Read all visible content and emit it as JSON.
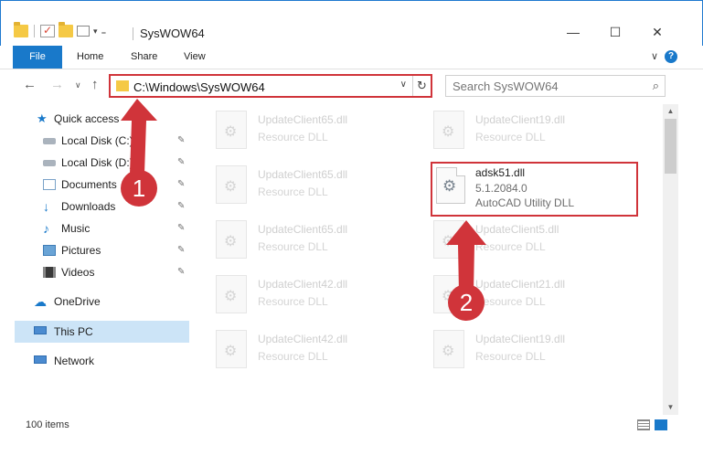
{
  "window": {
    "title": "SysWOW64",
    "minimize": "—",
    "maximize": "☐",
    "close": "✕"
  },
  "ribbon": {
    "tabs": [
      "File",
      "Home",
      "Share",
      "View"
    ],
    "collapse": "∨",
    "help": "?"
  },
  "nav": {
    "back": "←",
    "forward": "→",
    "recent": "∨",
    "up": "↑"
  },
  "address": {
    "path": "C:\\Windows\\SysWOW64",
    "dropdown": "∨",
    "refresh": "↻"
  },
  "search": {
    "placeholder": "Search SysWOW64",
    "icon": "⌕"
  },
  "sidebar": {
    "items": [
      {
        "label": "Quick access",
        "icon": "star-icon"
      },
      {
        "label": "Local Disk (C:)",
        "icon": "drive-icon",
        "pinned": true
      },
      {
        "label": "Local Disk (D:)",
        "icon": "drive-icon",
        "pinned": true
      },
      {
        "label": "Documents",
        "icon": "document-icon",
        "pinned": true
      },
      {
        "label": "Downloads",
        "icon": "download-icon",
        "pinned": true
      },
      {
        "label": "Music",
        "icon": "music-icon",
        "pinned": true
      },
      {
        "label": "Pictures",
        "icon": "pictures-icon",
        "pinned": true
      },
      {
        "label": "Videos",
        "icon": "video-icon",
        "pinned": true
      },
      {
        "label": "OneDrive",
        "icon": "cloud-icon"
      },
      {
        "label": "This PC",
        "icon": "computer-icon",
        "selected": true
      },
      {
        "label": "Network",
        "icon": "network-icon"
      }
    ],
    "pin_glyph": "✎"
  },
  "files": [
    {
      "name": "UpdateClient65.dll",
      "type": "Resource DLL"
    },
    {
      "name": "UpdateClient19.dll",
      "type": "Resource DLL"
    },
    {
      "name": "UpdateClient65.dll",
      "type": "Resource DLL"
    },
    {
      "name": "UpdateClient65.dll",
      "type": "Resource DLL"
    },
    {
      "name": "UpdateClient5.dll",
      "type": "Resource DLL"
    },
    {
      "name": "UpdateClient42.dll",
      "type": "Resource DLL"
    },
    {
      "name": "UpdateClient21.dll",
      "type": "Resource DLL"
    },
    {
      "name": "UpdateClient42.dll",
      "type": "Resource DLL"
    },
    {
      "name": "UpdateClient19.dll",
      "type": "Resource DLL"
    }
  ],
  "highlighted_file": {
    "name": "adsk51.dll",
    "version": "5.1.2084.0",
    "description": "AutoCAD Utility DLL"
  },
  "status": {
    "item_count": "100 items"
  },
  "annotations": {
    "marker1": "1",
    "marker2": "2",
    "color": "#d0343a"
  },
  "colors": {
    "accent": "#1979ca",
    "selection": "#cce4f7",
    "highlight_border": "#d0343a"
  }
}
